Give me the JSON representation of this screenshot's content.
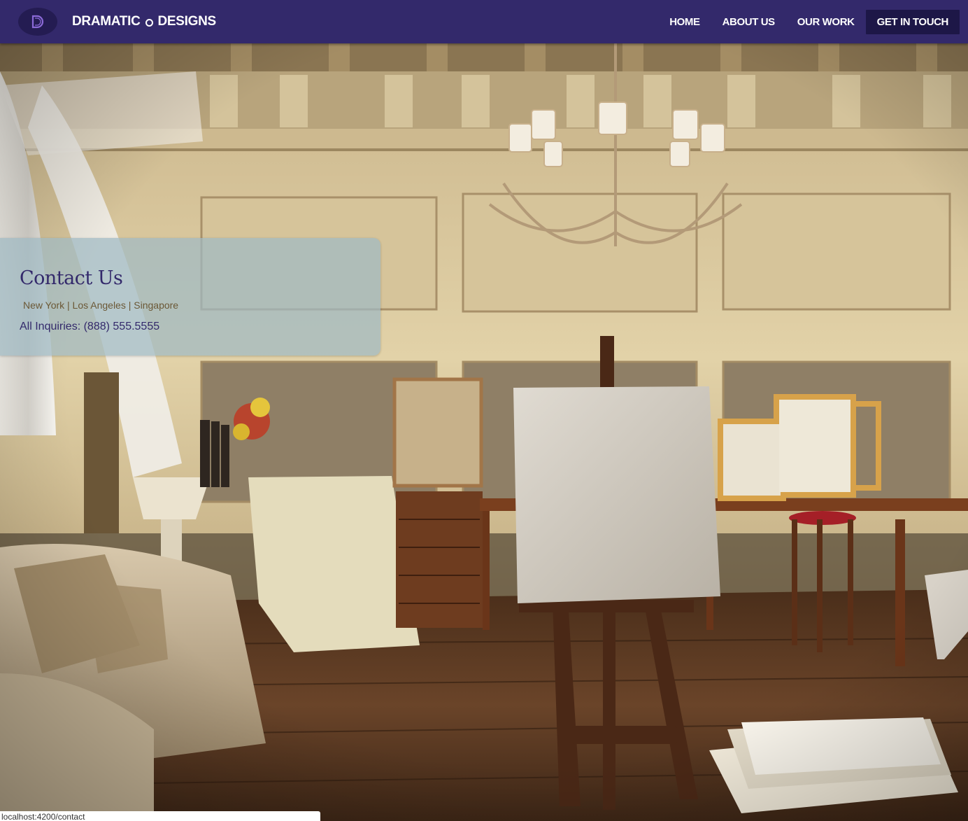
{
  "brand": {
    "name_part1": "DRAMATIC",
    "name_part2": "DESIGNS",
    "logo_icon": "d-monogram-logo"
  },
  "nav": {
    "items": [
      {
        "label": "HOME"
      },
      {
        "label": "ABOUT US"
      },
      {
        "label": "OUR WORK"
      }
    ],
    "cta_label": "GET IN TOUCH"
  },
  "contact": {
    "title": "Contact Us",
    "cities": "New York | Los Angeles | Singapore",
    "phone": "All Inquiries: (888) 555.5555"
  },
  "status_bar": {
    "url": "localhost:4200/contact"
  },
  "colors": {
    "nav_bg": "#33296b",
    "nav_cta_bg": "#1d1747",
    "accent_purple": "#33296b",
    "cities_text": "#6b5836",
    "card_bg": "rgba(160,186,196,0.72)"
  }
}
